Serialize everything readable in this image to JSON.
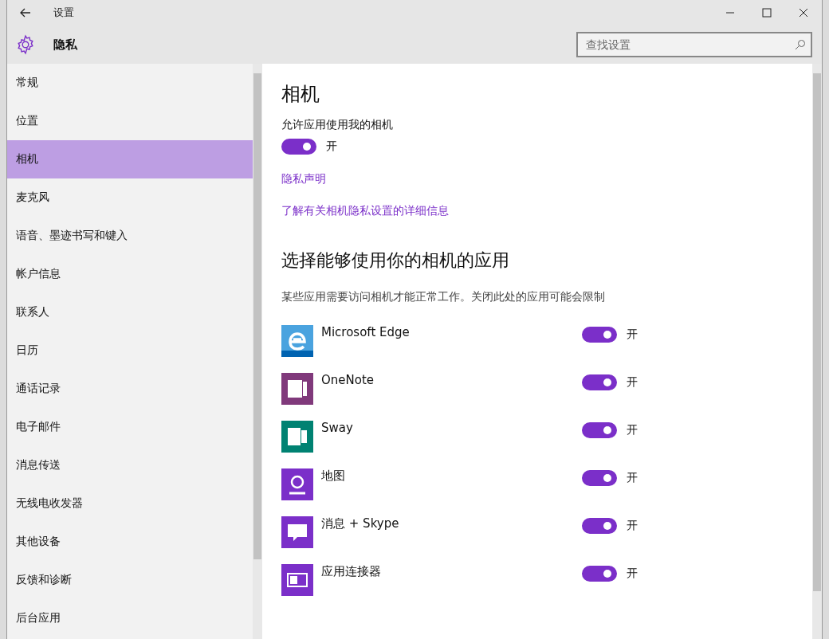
{
  "window": {
    "title": "设置"
  },
  "header": {
    "title": "隐私",
    "search": {
      "placeholder": "查找设置"
    }
  },
  "sidebar": {
    "items": [
      {
        "label": "常规",
        "selected": false
      },
      {
        "label": "位置",
        "selected": false
      },
      {
        "label": "相机",
        "selected": true
      },
      {
        "label": "麦克风",
        "selected": false
      },
      {
        "label": "语音、墨迹书写和键入",
        "selected": false
      },
      {
        "label": "帐户信息",
        "selected": false
      },
      {
        "label": "联系人",
        "selected": false
      },
      {
        "label": "日历",
        "selected": false
      },
      {
        "label": "通话记录",
        "selected": false
      },
      {
        "label": "电子邮件",
        "selected": false
      },
      {
        "label": "消息传送",
        "selected": false
      },
      {
        "label": "无线电收发器",
        "selected": false
      },
      {
        "label": "其他设备",
        "selected": false
      },
      {
        "label": "反馈和诊断",
        "selected": false
      },
      {
        "label": "后台应用",
        "selected": false
      }
    ]
  },
  "content": {
    "title": "相机",
    "allow_label": "允许应用使用我的相机",
    "allow_toggle": {
      "on": true,
      "label": "开"
    },
    "links": [
      "隐私声明",
      "了解有关相机隐私设置的详细信息"
    ],
    "apps_title": "选择能够使用你的相机的应用",
    "apps_description": "某些应用需要访问相机才能正常工作。关闭此处的应用可能会限制",
    "apps": [
      {
        "name": "Microsoft Edge",
        "kind": "edge",
        "on": true,
        "state_label": "开"
      },
      {
        "name": "OneNote",
        "kind": "onenote",
        "on": true,
        "state_label": "开"
      },
      {
        "name": "Sway",
        "kind": "sway",
        "on": true,
        "state_label": "开"
      },
      {
        "name": "地图",
        "kind": "maps",
        "on": true,
        "state_label": "开"
      },
      {
        "name": "消息 + Skype",
        "kind": "messaging",
        "on": true,
        "state_label": "开"
      },
      {
        "name": "应用连接器",
        "kind": "connector",
        "on": true,
        "state_label": "开"
      }
    ]
  }
}
